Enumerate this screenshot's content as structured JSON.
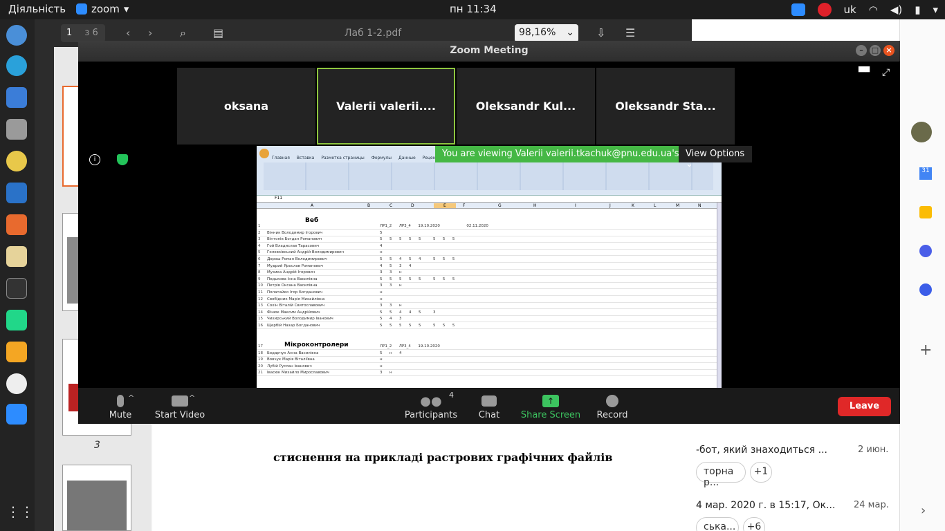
{
  "topbar": {
    "activities": "Діяльність",
    "app_name": "zoom",
    "clock": "пн 11:34",
    "language": "uk"
  },
  "pdf": {
    "page_current": "1",
    "page_total": "з 6",
    "title": "Лаб 1-2.pdf",
    "zoom": "98,16%",
    "thumb_page_label": "3",
    "visible_text": "стиснення на прикладі растрових графічних файлів"
  },
  "right_panel": {
    "msg1_text": "-бот, який знаходиться ...",
    "msg1_date": "2 июн.",
    "pill1": "торна р...",
    "pill1_count": "+1",
    "msg2_text": "4 мар. 2020 г. в 15:17, Ок...",
    "msg2_date": "24 мар.",
    "pill2": "ська...",
    "pill2_count": "+6"
  },
  "zoom": {
    "window_title": "Zoom Meeting",
    "participants": [
      {
        "name": "oksana",
        "active": false
      },
      {
        "name": "Valerii valerii....",
        "active": true
      },
      {
        "name": "Oleksandr Kul...",
        "active": false
      },
      {
        "name": "Oleksandr Sta...",
        "active": false
      }
    ],
    "share_banner": "You are viewing Valerii valerii.tkachuk@pnu.edu.ua's screen",
    "view_options": "View Options",
    "toolbar": {
      "mute": "Mute",
      "start_video": "Start Video",
      "participants": "Participants",
      "participant_count": "4",
      "chat": "Chat",
      "share_screen": "Share Screen",
      "record": "Record",
      "leave": "Leave"
    },
    "colors": {
      "accent_green": "#45b845",
      "active_border": "#8ec63f",
      "leave_red": "#e02828",
      "share_green": "#3cc35f"
    }
  },
  "spreadsheet": {
    "ribbon_tabs": [
      "Главная",
      "Вставка",
      "Разметка страницы",
      "Формулы",
      "Данные",
      "Рецензирование"
    ],
    "cell_ref": "F11",
    "columns": [
      "A",
      "B",
      "C",
      "D",
      "E",
      "F",
      "G",
      "H",
      "I",
      "J",
      "K",
      "L",
      "M",
      "N"
    ],
    "section1": "Веб",
    "section2": "Мікроконтролери",
    "rows": [
      {
        "n": "1",
        "name": "",
        "cells": "ЛР1_2      ЛР3_4      19.10.2020                      02.11.2020"
      },
      {
        "n": "2",
        "name": "Вінник Володимир Ігорович",
        "cells": "5"
      },
      {
        "n": "3",
        "name": "Вінтонів Богдан Романович",
        "cells": "5      5      5      5      5          5      5      5"
      },
      {
        "n": "4",
        "name": "Гой Владислав Тарасович",
        "cells": "4"
      },
      {
        "n": "5",
        "name": "Головківський Андрій Володимирович",
        "cells": "н"
      },
      {
        "n": "6",
        "name": "Дорош Роман Володимирович",
        "cells": "5      5      4      5      4          5      5      5"
      },
      {
        "n": "7",
        "name": "Мудрий Ярослав Романович",
        "cells": "4      5      3      4"
      },
      {
        "n": "8",
        "name": "Музика Андрій Ігорович",
        "cells": "3      3      н"
      },
      {
        "n": "9",
        "name": "Педькова Інна Василівна",
        "cells": "5      5      5      5      5          5      5      5"
      },
      {
        "n": "10",
        "name": "Петрів Оксана Василівна",
        "cells": "3      3      н"
      },
      {
        "n": "11",
        "name": "Полатайко Ігор Богданович",
        "cells": "н"
      },
      {
        "n": "12",
        "name": "Свобідник Марія Михайлівна",
        "cells": "н"
      },
      {
        "n": "13",
        "name": "Сохін Віталій Святославович",
        "cells": "3      3      н"
      },
      {
        "n": "14",
        "name": "Фінюк Максим Андрійович",
        "cells": "5      5      4      4      5          3"
      },
      {
        "n": "15",
        "name": "Чихирський Володимир Іванович",
        "cells": "5      4      3"
      },
      {
        "n": "16",
        "name": "Щербій Назар Богданович",
        "cells": "5      5      5      5      5          5      5      5"
      },
      {
        "n": "17",
        "name": "",
        "cells": "ЛР1_2      ЛР3_4      19.10.2020"
      },
      {
        "n": "18",
        "name": "Бодарчук Анна Василівна",
        "cells": "5      н      4"
      },
      {
        "n": "19",
        "name": "Вовчук Марія Віталіївна",
        "cells": "н"
      },
      {
        "n": "20",
        "name": "Лубій Руслан Іванович",
        "cells": "н"
      },
      {
        "n": "21",
        "name": "Івасюк Михайло Мирославович",
        "cells": "3      н"
      }
    ]
  }
}
